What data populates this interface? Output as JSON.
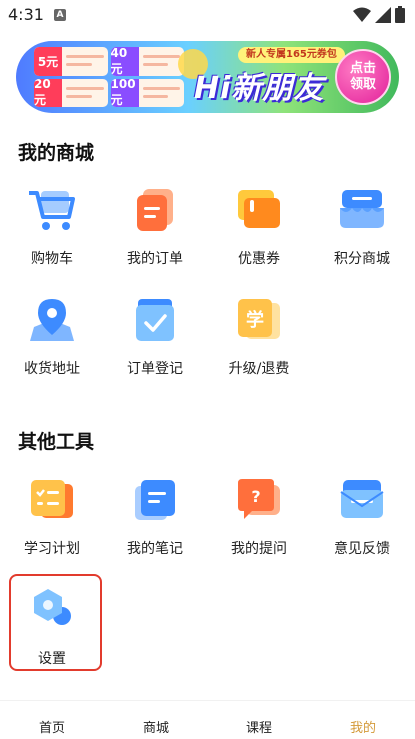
{
  "status_bar": {
    "time": "4:31",
    "notif_letter": "A"
  },
  "banner": {
    "tag": "新人专属165元券包",
    "title": "Hi新朋友",
    "cta_line1": "点击",
    "cta_line2": "领取",
    "coupons": [
      {
        "amount": "5元"
      },
      {
        "amount": "40元"
      },
      {
        "amount": "20元"
      },
      {
        "amount": "100元"
      }
    ]
  },
  "mall": {
    "title": "我的商城",
    "items": [
      {
        "label": "购物车",
        "icon": "shopping-cart-icon"
      },
      {
        "label": "我的订单",
        "icon": "order-icon"
      },
      {
        "label": "优惠券",
        "icon": "coupon-icon"
      },
      {
        "label": "积分商城",
        "icon": "points-store-icon"
      },
      {
        "label": "收货地址",
        "icon": "location-icon"
      },
      {
        "label": "订单登记",
        "icon": "order-register-icon"
      },
      {
        "label": "升级/退费",
        "icon": "upgrade-refund-icon"
      }
    ]
  },
  "tools": {
    "title": "其他工具",
    "items": [
      {
        "label": "学习计划",
        "icon": "study-plan-icon"
      },
      {
        "label": "我的笔记",
        "icon": "notes-icon"
      },
      {
        "label": "我的提问",
        "icon": "questions-icon"
      },
      {
        "label": "意见反馈",
        "icon": "feedback-icon"
      },
      {
        "label": "设置",
        "icon": "settings-icon"
      }
    ]
  },
  "bottom_nav": {
    "items": [
      {
        "label": "首页"
      },
      {
        "label": "商城"
      },
      {
        "label": "课程"
      },
      {
        "label": "我的"
      }
    ],
    "active_index": 3
  },
  "colors": {
    "accent": "#d49a3a",
    "highlight": "#e23b2d",
    "blue": "#3d8bff",
    "orange": "#ff7a2f"
  }
}
